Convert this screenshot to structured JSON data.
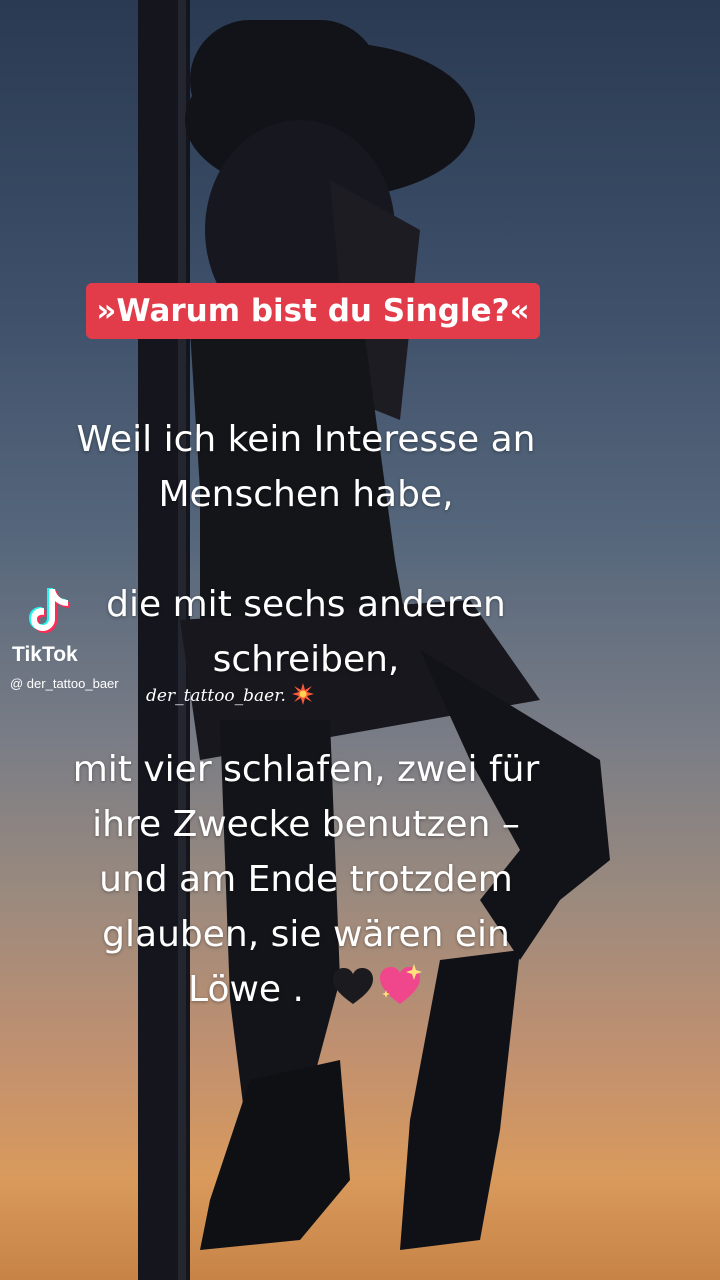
{
  "caption": "»Warum bist du Single?«",
  "lyric_lines": [
    "Weil ich kein Interesse an",
    "Menschen habe,",
    "die mit sechs anderen",
    "schreiben,",
    "mit vier schlafen, zwei für",
    "ihre Zwecke benutzen –",
    "und am Ende trotzdem",
    "glauben, sie wären ein",
    "Löwe ."
  ],
  "watermark": {
    "app_name": "TikTok",
    "handle": "@ der_tattoo_baer",
    "overlay_text": "der_tattoo_baer."
  },
  "emojis": [
    "collision-icon",
    "black-heart-icon",
    "sparkling-heart-icon"
  ],
  "colors": {
    "caption_background": "#e23b4a",
    "text": "#ffffff",
    "tiktok_cyan": "#25f4ee",
    "tiktok_red": "#fe2c55"
  }
}
